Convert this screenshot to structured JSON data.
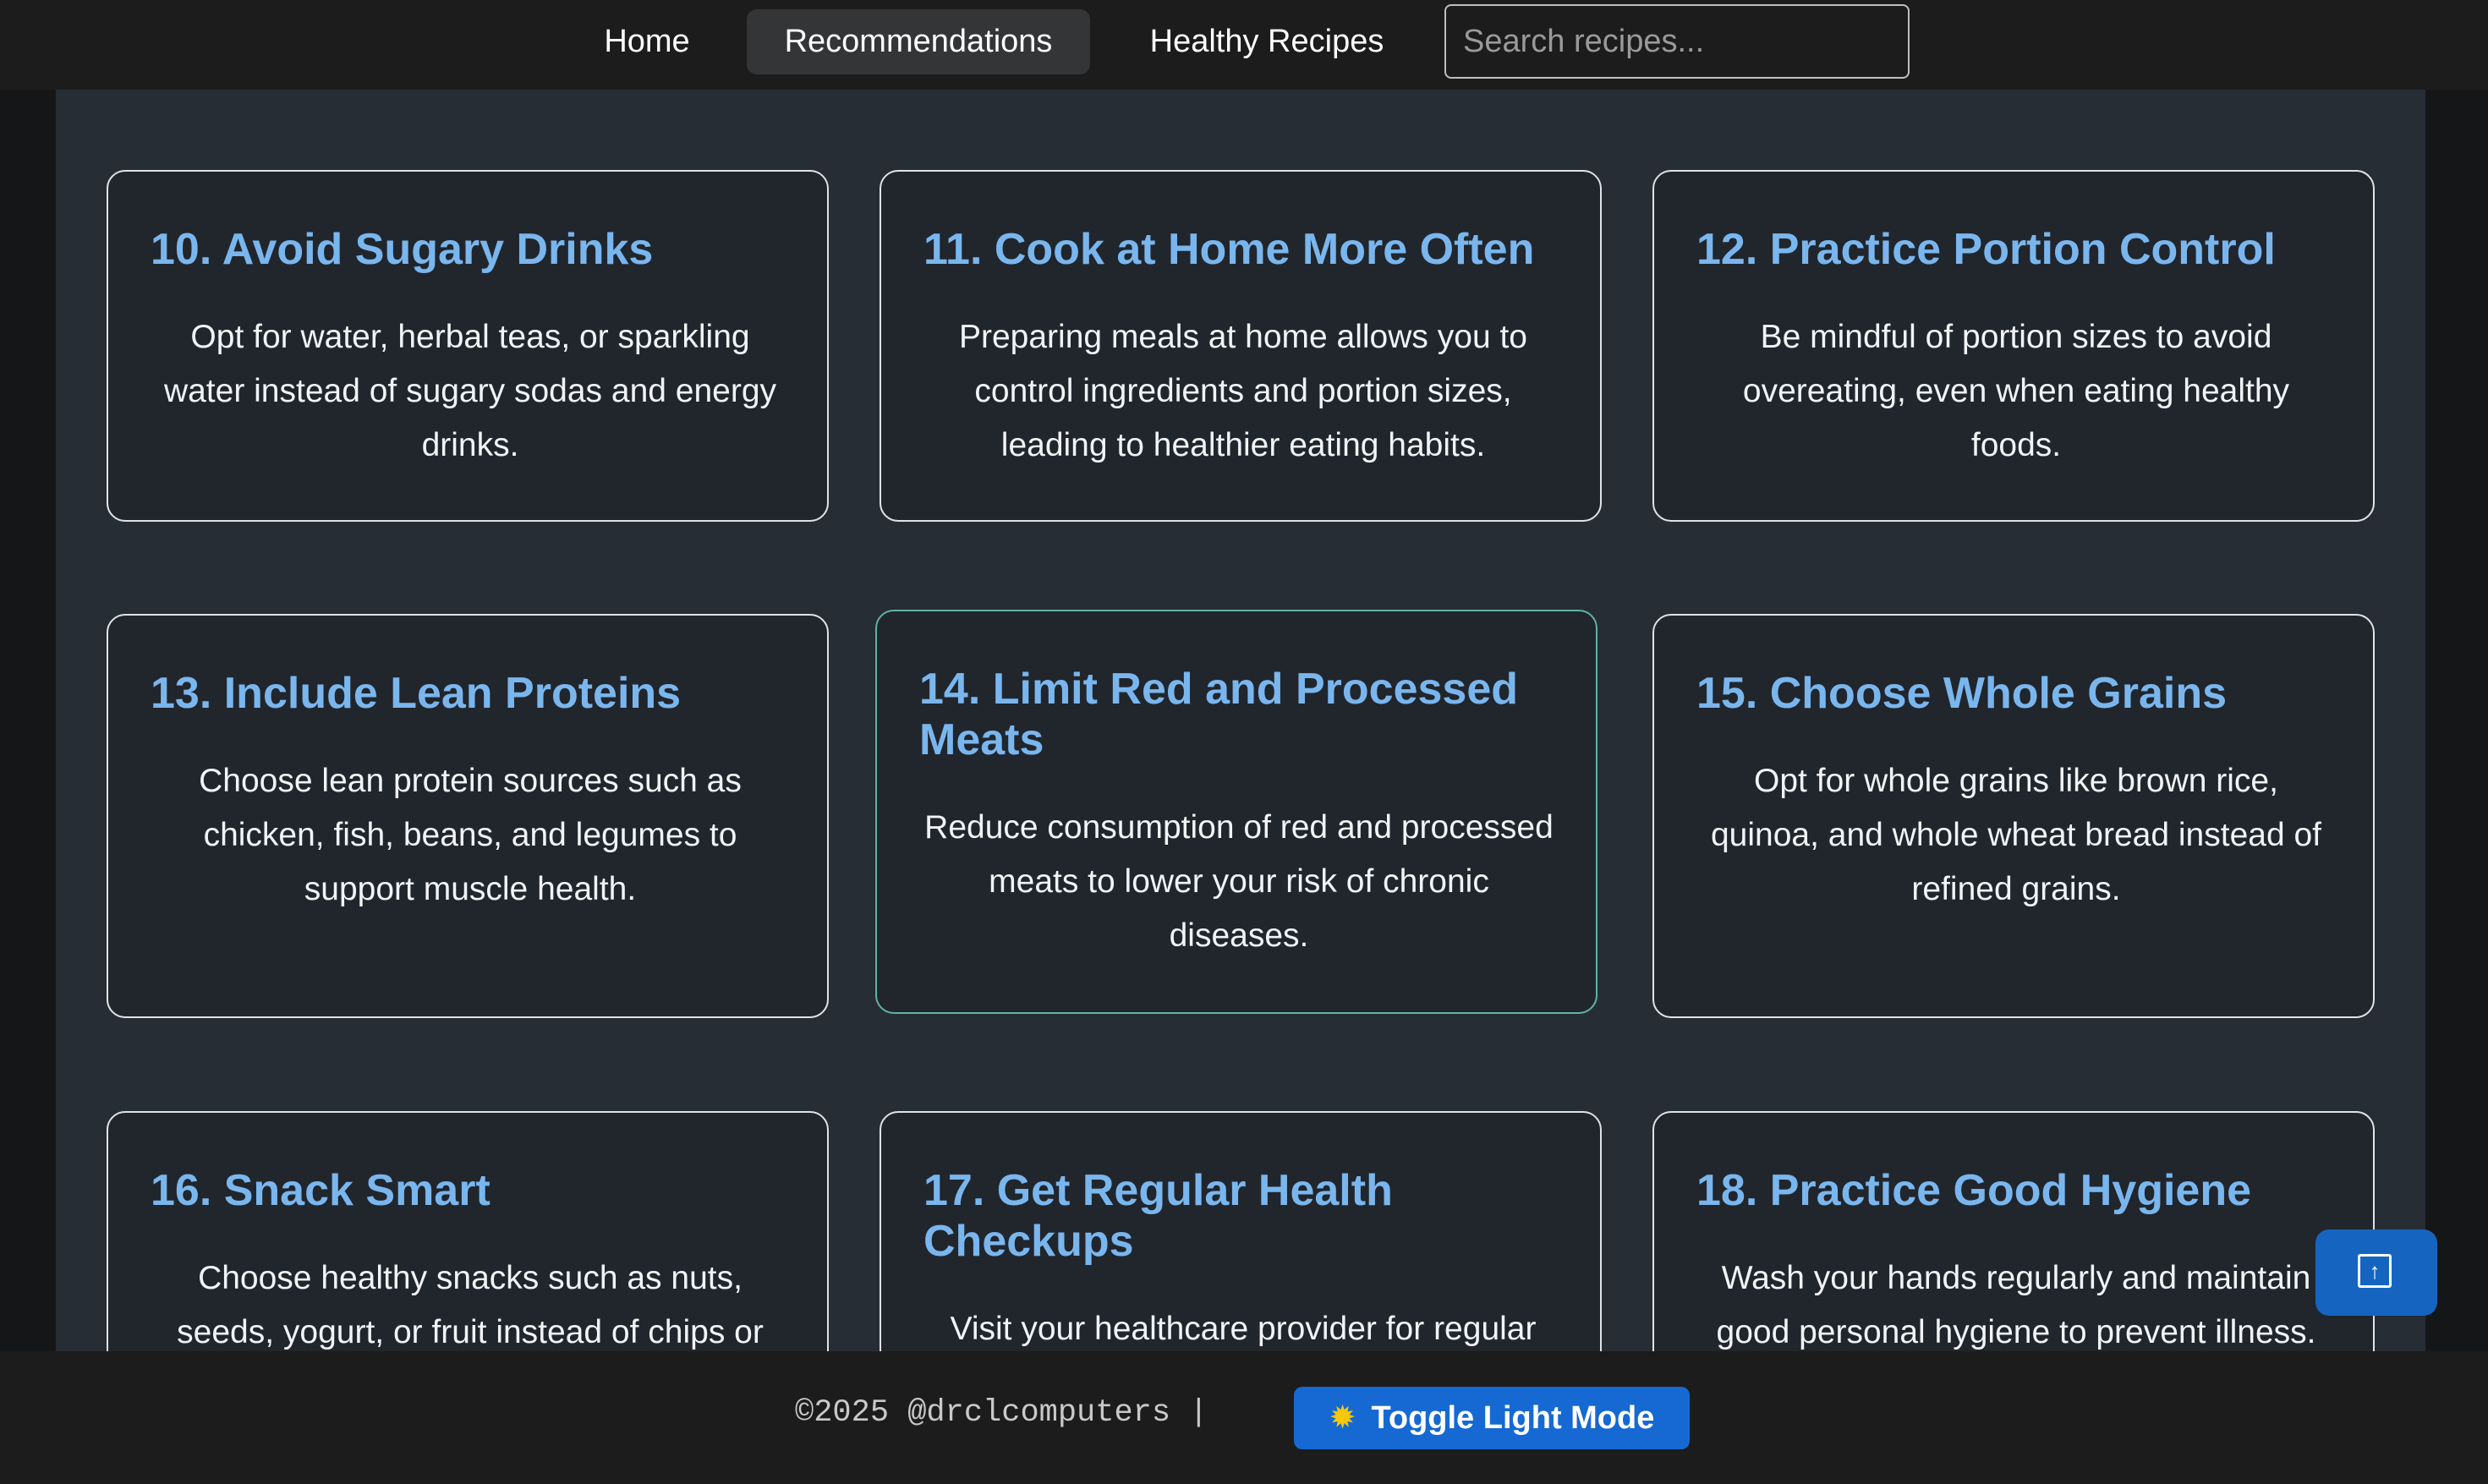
{
  "nav": {
    "home": "Home",
    "recommendations": "Recommendations",
    "healthy_recipes": "Healthy Recipes",
    "search_placeholder": "Search recipes..."
  },
  "cards": [
    {
      "title": "10. Avoid Sugary Drinks",
      "text": "Opt for water, herbal teas, or sparkling water instead of sugary sodas and energy drinks."
    },
    {
      "title": "11. Cook at Home More Often",
      "text": "Preparing meals at home allows you to control ingredients and portion sizes, leading to healthier eating habits."
    },
    {
      "title": "12. Practice Portion Control",
      "text": "Be mindful of portion sizes to avoid overeating, even when eating healthy foods."
    },
    {
      "title": "13. Include Lean Proteins",
      "text": "Choose lean protein sources such as chicken, fish, beans, and legumes to support muscle health."
    },
    {
      "title": "14. Limit Red and Processed Meats",
      "text": "Reduce consumption of red and processed meats to lower your risk of chronic diseases."
    },
    {
      "title": "15. Choose Whole Grains",
      "text": "Opt for whole grains like brown rice, quinoa, and whole wheat bread instead of refined grains."
    },
    {
      "title": "16. Snack Smart",
      "text": "Choose healthy snacks such as nuts, seeds, yogurt, or fruit instead of chips or"
    },
    {
      "title": "17. Get Regular Health Checkups",
      "text": "Visit your healthcare provider for regular"
    },
    {
      "title": "18. Practice Good Hygiene",
      "text": "Wash your hands regularly and maintain good personal hygiene to prevent illness."
    }
  ],
  "footer": {
    "copyright": "©2025 @drclcomputers |",
    "toggle_label": "Toggle Light Mode",
    "toggle_icon": "sun-icon"
  },
  "scroll_top": {
    "icon": "arrow-up-icon",
    "glyph": "↑"
  },
  "colors": {
    "accent": "#1669d2",
    "title": "#7ab6ee",
    "highlight_border": "#5fb3a5"
  }
}
